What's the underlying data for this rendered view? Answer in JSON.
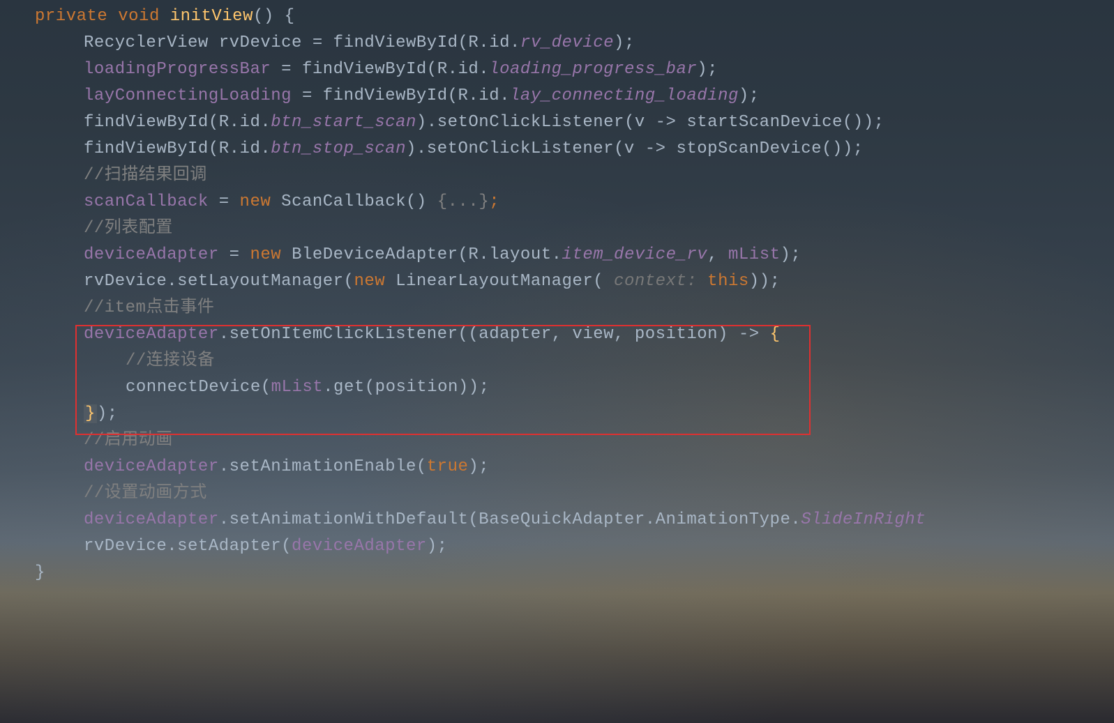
{
  "code": {
    "l1_private": "private",
    "l1_void": "void",
    "l1_method": "initView",
    "l1_rest": "() {",
    "l2_type": "RecyclerView",
    "l2_var": "rvDevice = ",
    "l2_find": "findViewById",
    "l2_r": "(R.id.",
    "l2_id": "rv_device",
    "l2_end": ");",
    "l3_field": "loadingProgressBar",
    "l3_eq": " = ",
    "l3_find": "findViewById",
    "l3_r": "(R.id.",
    "l3_id": "loading_progress_bar",
    "l3_end": ");",
    "l4_field": "layConnectingLoading",
    "l4_eq": " = ",
    "l4_find": "findViewById",
    "l4_r": "(R.id.",
    "l4_id": "lay_connecting_loading",
    "l4_end": ");",
    "l5_find": "findViewById",
    "l5_r": "(R.id.",
    "l5_id": "btn_start_scan",
    "l5_mid": ").setOnClickListener(v -> startScanDevice());",
    "l6_find": "findViewById",
    "l6_r": "(R.id.",
    "l6_id": "btn_stop_scan",
    "l6_mid": ").setOnClickListener(v -> stopScanDevice());",
    "l7_comment": "//扫描结果回调",
    "l8_field": "scanCallback",
    "l8_eq": " = ",
    "l8_new": "new",
    "l8_type": " ScanCallback() ",
    "l8_fold": "{...}",
    "l8_end": ";",
    "l9_comment": "//列表配置",
    "l10_field": "deviceAdapter",
    "l10_eq": " = ",
    "l10_new": "new",
    "l10_type": " BleDeviceAdapter(R.layout.",
    "l10_id": "item_device_rv",
    "l10_mid": ", ",
    "l10_mlist": "mList",
    "l10_end": ");",
    "l11_pre": "rvDevice.setLayoutManager(",
    "l11_new": "new",
    "l11_type": " LinearLayoutManager( ",
    "l11_hint": "context: ",
    "l11_this": "this",
    "l11_end": "));",
    "l12_comment": "//item点击事件",
    "l13_field": "deviceAdapter",
    "l13_mid": ".setOnItemClickListener((adapter, view, position) -> ",
    "l13_brace": "{",
    "l14_comment": "//连接设备",
    "l15_call": "connectDevice(",
    "l15_mlist": "mList",
    "l15_mid": ".get(position));",
    "l16_brace": "}",
    "l16_end": ");",
    "l17_comment": "//启用动画",
    "l18_field": "deviceAdapter",
    "l18_mid": ".setAnimationEnable(",
    "l18_bool": "true",
    "l18_end": ");",
    "l19_comment": "//设置动画方式",
    "l20_field": "deviceAdapter",
    "l20_mid": ".setAnimationWithDefault(BaseQuickAdapter.AnimationType.",
    "l20_const": "SlideInRight",
    "l21_pre": "rvDevice.setAdapter(",
    "l21_field": "deviceAdapter",
    "l21_end": ");",
    "l22": "}"
  }
}
